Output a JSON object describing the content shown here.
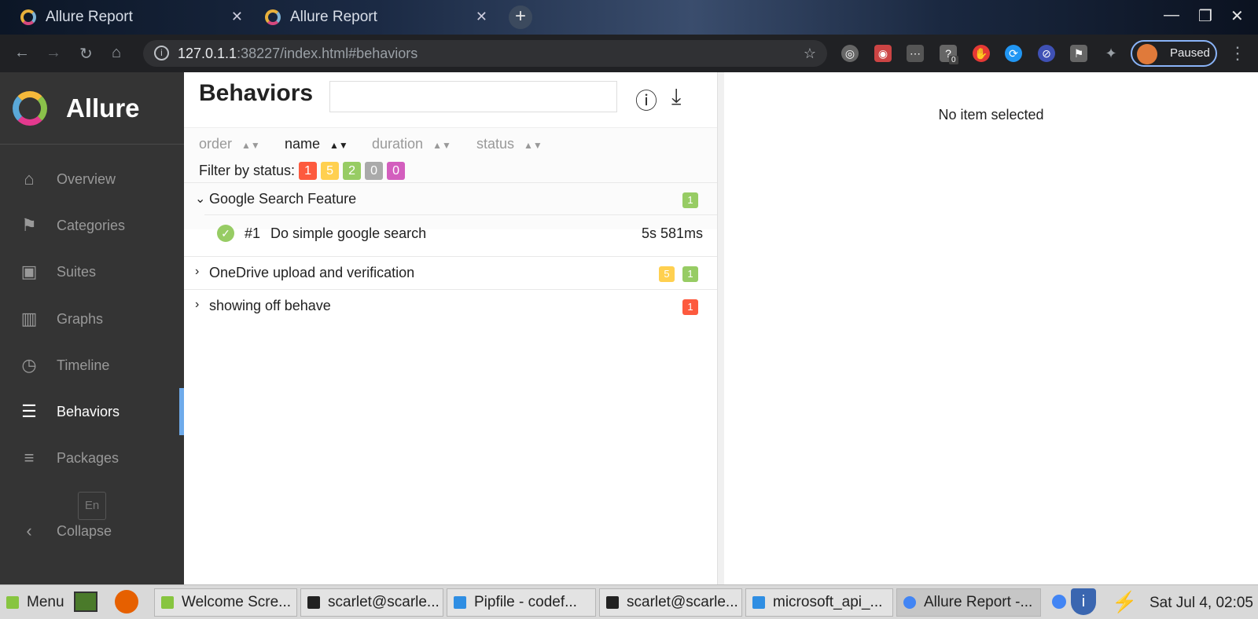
{
  "browser": {
    "tabs": [
      {
        "title": "Allure Report"
      },
      {
        "title": "Allure Report"
      }
    ],
    "new_tab": "+",
    "url_host": "127.0.1.1",
    "url_path": ":38227/index.html#behaviors",
    "profile_label": "Paused",
    "ext_badge": "0"
  },
  "sidebar": {
    "brand": "Allure",
    "items": [
      {
        "label": "Overview",
        "icon": "home-icon"
      },
      {
        "label": "Categories",
        "icon": "flag-icon"
      },
      {
        "label": "Suites",
        "icon": "briefcase-icon"
      },
      {
        "label": "Graphs",
        "icon": "bar-chart-icon"
      },
      {
        "label": "Timeline",
        "icon": "clock-icon"
      },
      {
        "label": "Behaviors",
        "icon": "list-icon",
        "active": true
      },
      {
        "label": "Packages",
        "icon": "align-left-icon"
      }
    ],
    "language": "En",
    "collapse": "Collapse"
  },
  "main": {
    "title": "Behaviors",
    "search_placeholder": "",
    "sort": [
      {
        "label": "order"
      },
      {
        "label": "name",
        "active": true
      },
      {
        "label": "duration"
      },
      {
        "label": "status"
      }
    ],
    "filter_label": "Filter by status:",
    "status_counts": [
      {
        "value": "1",
        "color": "#fd5a3e"
      },
      {
        "value": "5",
        "color": "#ffd050"
      },
      {
        "value": "2",
        "color": "#97cc64"
      },
      {
        "value": "0",
        "color": "#aaaaaa"
      },
      {
        "value": "0",
        "color": "#d35ebe"
      }
    ],
    "groups": [
      {
        "name": "Google Search Feature",
        "expanded": true,
        "badges": [
          {
            "value": "1",
            "color": "#97cc64"
          }
        ],
        "cases": [
          {
            "num": "#1",
            "name": "Do simple google search",
            "duration": "5s 581ms",
            "status": "passed"
          }
        ]
      },
      {
        "name": "OneDrive upload and verification",
        "expanded": false,
        "badges": [
          {
            "value": "5",
            "color": "#ffd050"
          },
          {
            "value": "1",
            "color": "#97cc64"
          }
        ]
      },
      {
        "name": "showing off behave",
        "expanded": false,
        "badges": [
          {
            "value": "1",
            "color": "#fd5a3e"
          }
        ]
      }
    ]
  },
  "detail": {
    "empty_text": "No item selected"
  },
  "taskbar": {
    "menu": "Menu",
    "items": [
      {
        "label": "Welcome Scre..."
      },
      {
        "label": "scarlet@scarle..."
      },
      {
        "label": "Pipfile - codef..."
      },
      {
        "label": "scarlet@scarle..."
      },
      {
        "label": "microsoft_api_..."
      },
      {
        "label": "Allure Report -..."
      }
    ],
    "clock": "Sat Jul  4, 02:05"
  }
}
